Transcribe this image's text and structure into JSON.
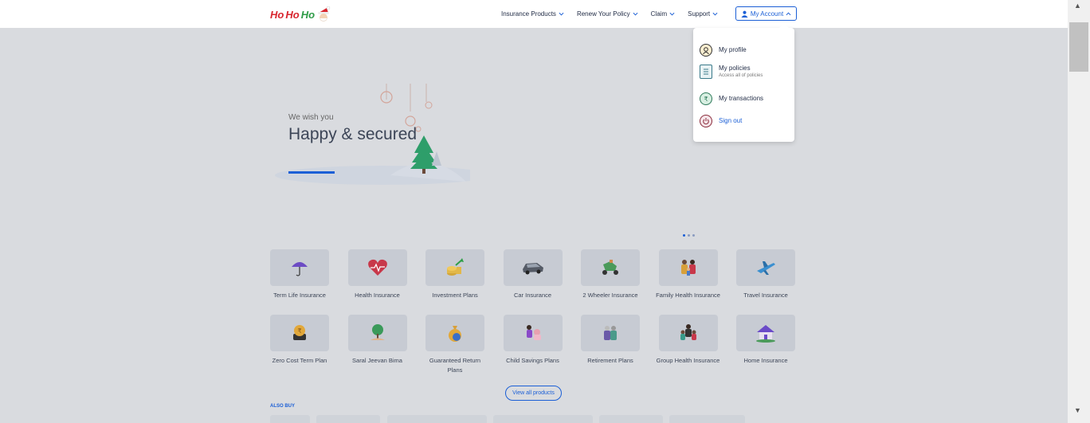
{
  "header": {
    "logo_text": "HoHoHo",
    "nav": [
      {
        "label": "Insurance Products"
      },
      {
        "label": "Renew Your Policy"
      },
      {
        "label": "Claim"
      },
      {
        "label": "Support"
      }
    ],
    "account_label": "My Account"
  },
  "account_menu": {
    "items": [
      {
        "label": "My profile",
        "sub": "",
        "icon": "profile-icon"
      },
      {
        "label": "My policies",
        "sub": "Access all of policies",
        "icon": "policies-icon"
      },
      {
        "label": "My transactions",
        "sub": "",
        "icon": "transactions-icon"
      },
      {
        "label": "Sign out",
        "sub": "",
        "icon": "power-icon"
      }
    ]
  },
  "hero": {
    "wish": "We wish you",
    "headline": "Happy & secured",
    "carousel_slides": 3,
    "carousel_active": 1
  },
  "products": [
    {
      "label": "Term Life Insurance",
      "icon": "umbrella-icon"
    },
    {
      "label": "Health Insurance",
      "icon": "heart-icon"
    },
    {
      "label": "Investment Plans",
      "icon": "coins-icon"
    },
    {
      "label": "Car Insurance",
      "icon": "car-icon"
    },
    {
      "label": "2 Wheeler Insurance",
      "icon": "scooter-icon"
    },
    {
      "label": "Family Health Insurance",
      "icon": "family-icon"
    },
    {
      "label": "Travel Insurance",
      "icon": "plane-icon"
    },
    {
      "label": "Zero Cost Term Plan",
      "icon": "coin-stack-icon"
    },
    {
      "label": "Saral Jeevan Bima",
      "icon": "tree-icon"
    },
    {
      "label": "Guaranteed Return Plans",
      "icon": "money-bag-icon"
    },
    {
      "label": "Child Savings Plans",
      "icon": "child-icon"
    },
    {
      "label": "Retirement Plans",
      "icon": "elderly-couple-icon"
    },
    {
      "label": "Group Health Insurance",
      "icon": "group-icon"
    },
    {
      "label": "Home Insurance",
      "icon": "house-icon"
    }
  ],
  "view_all_label": "View all products",
  "also_buy_label": "ALSO BUY",
  "colors": {
    "accent": "#1b5fd6",
    "background": "#d9dbdf",
    "tile": "#c7cbd3"
  }
}
